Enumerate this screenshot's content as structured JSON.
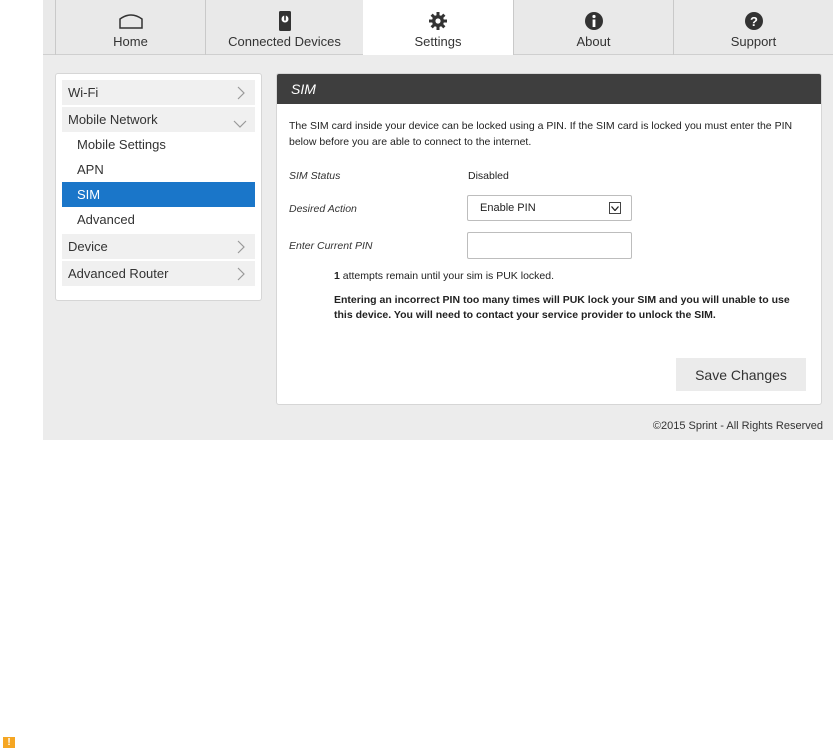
{
  "nav": {
    "tabs": [
      {
        "label": "Home",
        "icon": "home-icon"
      },
      {
        "label": "Connected Devices",
        "icon": "device-icon"
      },
      {
        "label": "Settings",
        "icon": "gear-icon"
      },
      {
        "label": "About",
        "icon": "info-icon"
      },
      {
        "label": "Support",
        "icon": "question-icon"
      }
    ],
    "active": "Settings"
  },
  "sidebar": {
    "items": [
      {
        "label": "Wi-Fi"
      },
      {
        "label": "Mobile Network"
      },
      {
        "label": "Mobile Settings"
      },
      {
        "label": "APN"
      },
      {
        "label": "SIM"
      },
      {
        "label": "Advanced"
      },
      {
        "label": "Device"
      },
      {
        "label": "Advanced Router"
      }
    ],
    "active": "SIM"
  },
  "panel": {
    "title": "SIM",
    "intro": "The SIM card inside your device can be locked using a PIN. If the SIM card is locked you must enter the PIN below before you are able to connect to the internet.",
    "status_label": "SIM Status",
    "status_value": "Disabled",
    "action_label": "Desired Action",
    "action_value": "Enable PIN",
    "pin_label": "Enter Current PIN",
    "pin_value": "",
    "attempts_count": "1",
    "attempts_text": " attempts remain until your sim is PUK locked.",
    "warning": "Entering an incorrect PIN too many times will PUK lock your SIM and you will unable to use this device. You will need to contact your service provider to unlock the SIM.",
    "save_label": "Save Changes"
  },
  "footer": "©2015 Sprint - All Rights Reserved",
  "colors": {
    "accent": "#1a76c9",
    "header": "#3e3e3e",
    "warn": "#f5a623"
  }
}
